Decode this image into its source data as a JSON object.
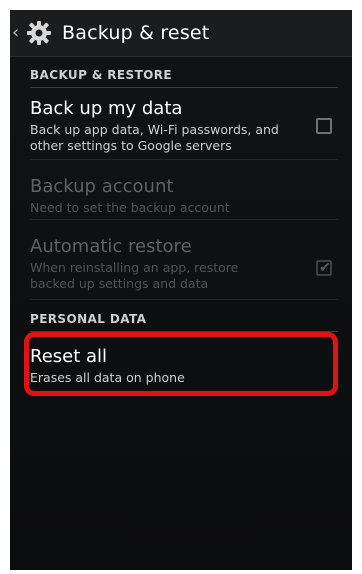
{
  "actionbar": {
    "back_glyph": "‹",
    "title": "Backup & reset",
    "icon": "gear-icon"
  },
  "sections": {
    "backup_restore": "BACKUP & RESTORE",
    "personal_data": "PERSONAL DATA"
  },
  "items": {
    "back_up_data": {
      "title": "Back up my data",
      "summary": "Back up app data, Wi-Fi passwords, and other settings to Google servers",
      "checked": false
    },
    "backup_account": {
      "title": "Backup account",
      "summary": "Need to set the backup account"
    },
    "automatic_restore": {
      "title": "Automatic restore",
      "summary": "When reinstalling an app, restore backed up settings and data",
      "checked": true
    },
    "reset_all": {
      "title": "Reset all",
      "summary": "Erases all data on phone"
    }
  },
  "colors": {
    "highlight": "#e01212",
    "background": "#0b0c0d",
    "text_primary": "#ffffff",
    "text_disabled": "#5f6163"
  }
}
